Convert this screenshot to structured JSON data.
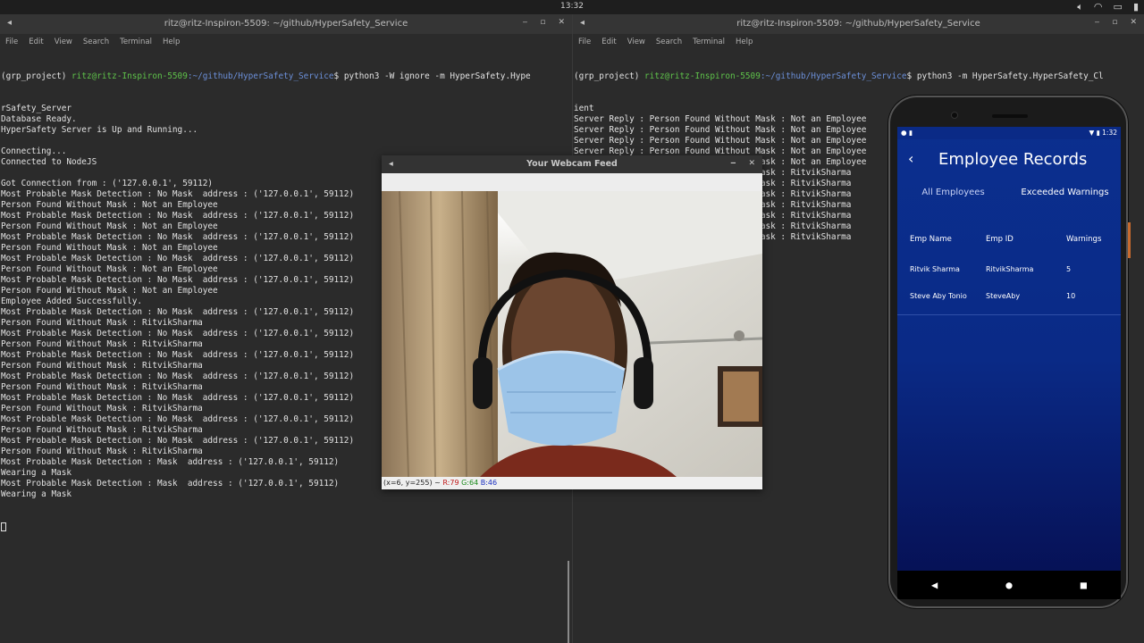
{
  "system": {
    "clock": "13:32",
    "tray_icons": [
      "volume-icon",
      "wifi-icon",
      "printer-icon",
      "battery-icon"
    ]
  },
  "terminal_left": {
    "title": "ritz@ritz-Inspiron-5509: ~/github/HyperSafety_Service",
    "menu": [
      "File",
      "Edit",
      "View",
      "Search",
      "Terminal",
      "Help"
    ],
    "prompt": {
      "env": "(grp_project) ",
      "user": "ritz@ritz-Inspiron-5509",
      "path": ":~/github/HyperSafety_Service",
      "command": "$ python3 -W ignore -m HyperSafety.Hype"
    },
    "lines": [
      "rSafety_Server",
      "Database Ready.",
      "HyperSafety Server is Up and Running...",
      "",
      "Connecting...",
      "Connected to NodeJS",
      "",
      "Got Connection from : ('127.0.0.1', 59112)",
      "Most Probable Mask Detection : No Mask  address : ('127.0.0.1', 59112)",
      "Person Found Without Mask : Not an Employee",
      "Most Probable Mask Detection : No Mask  address : ('127.0.0.1', 59112)",
      "Person Found Without Mask : Not an Employee",
      "Most Probable Mask Detection : No Mask  address : ('127.0.0.1', 59112)",
      "Person Found Without Mask : Not an Employee",
      "Most Probable Mask Detection : No Mask  address : ('127.0.0.1', 59112)",
      "Person Found Without Mask : Not an Employee",
      "Most Probable Mask Detection : No Mask  address : ('127.0.0.1', 59112)",
      "Person Found Without Mask : Not an Employee",
      "Employee Added Successfully.",
      "Most Probable Mask Detection : No Mask  address : ('127.0.0.1', 59112)",
      "Person Found Without Mask : RitvikSharma",
      "Most Probable Mask Detection : No Mask  address : ('127.0.0.1', 59112)",
      "Person Found Without Mask : RitvikSharma",
      "Most Probable Mask Detection : No Mask  address : ('127.0.0.1', 59112)",
      "Person Found Without Mask : RitvikSharma",
      "Most Probable Mask Detection : No Mask  address : ('127.0.0.1', 59112)",
      "Person Found Without Mask : RitvikSharma",
      "Most Probable Mask Detection : No Mask  address : ('127.0.0.1', 59112)",
      "Person Found Without Mask : RitvikSharma",
      "Most Probable Mask Detection : No Mask  address : ('127.0.0.1', 59112)",
      "Person Found Without Mask : RitvikSharma",
      "Most Probable Mask Detection : No Mask  address : ('127.0.0.1', 59112)",
      "Person Found Without Mask : RitvikSharma",
      "Most Probable Mask Detection : Mask  address : ('127.0.0.1', 59112)",
      "Wearing a Mask",
      "Most Probable Mask Detection : Mask  address : ('127.0.0.1', 59112)",
      "Wearing a Mask"
    ]
  },
  "terminal_right": {
    "title": "ritz@ritz-Inspiron-5509: ~/github/HyperSafety_Service",
    "menu": [
      "File",
      "Edit",
      "View",
      "Search",
      "Terminal",
      "Help"
    ],
    "prompt": {
      "env": "(grp_project) ",
      "user": "ritz@ritz-Inspiron-5509",
      "path": ":~/github/HyperSafety_Service",
      "command": "$ python3 -m HyperSafety.HyperSafety_Cl"
    },
    "lines": [
      "ient",
      "Server Reply : Person Found Without Mask : Not an Employee",
      "Server Reply : Person Found Without Mask : Not an Employee",
      "Server Reply : Person Found Without Mask : Not an Employee",
      "Server Reply : Person Found Without Mask : Not an Employee",
      "Server Reply : Person Found Without Mask : Not an Employee",
      "Server Reply : Person Found Without Mask : RitvikSharma",
      "Server Reply : Person Found Without Mask : RitvikSharma",
      "Server Reply : Person Found Without Mask : RitvikSharma",
      "Server Reply : Person Found Without Mask : RitvikSharma",
      "Server Reply : Person Found Without Mask : RitvikSharma",
      "Server Reply : Person Found Without Mask : RitvikSharma",
      "Server Reply : Person Found Without Mask : RitvikSharma"
    ]
  },
  "webcam": {
    "title": "Your Webcam Feed",
    "status_prefix": "(x=6, y=255) ~ ",
    "r": "R:79",
    "g": "G:64",
    "b": "B:46"
  },
  "phone": {
    "status_time": "1:32",
    "title": "Employee Records",
    "tabs": [
      "All Employees",
      "Exceeded Warnings"
    ],
    "active_tab": "Exceeded Warnings",
    "columns": [
      "Emp Name",
      "Emp ID",
      "Warnings"
    ],
    "rows": [
      {
        "name": "Ritvik Sharma",
        "id": "RitvikSharma",
        "warnings": "5"
      },
      {
        "name": "Steve Aby Tonio",
        "id": "SteveAby",
        "warnings": "10"
      }
    ],
    "nav": [
      "back-icon",
      "home-icon",
      "recents-icon"
    ]
  }
}
